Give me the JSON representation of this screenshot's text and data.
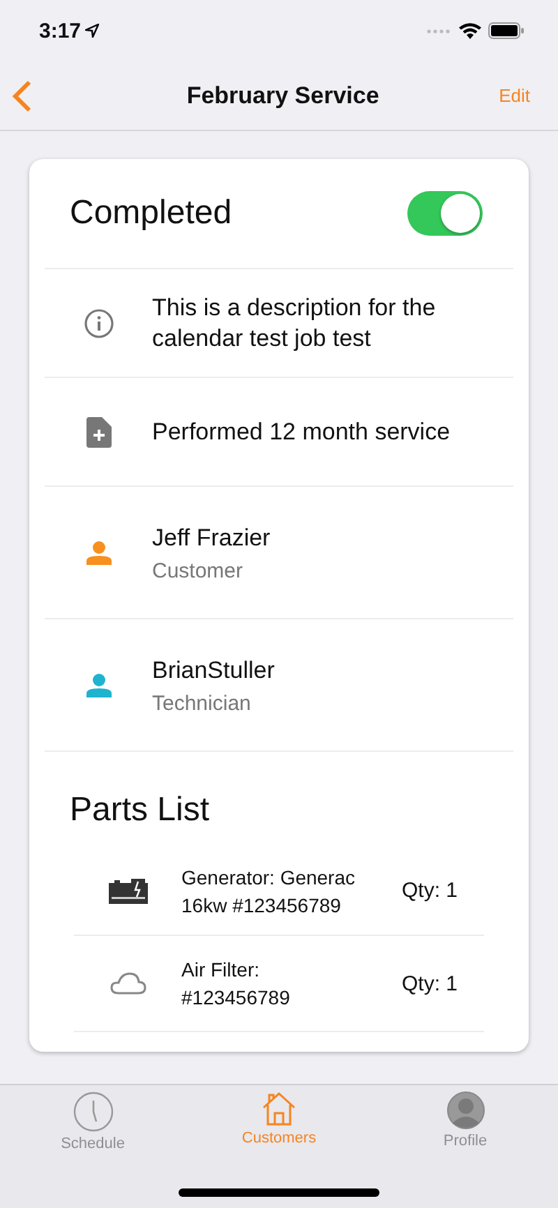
{
  "status_bar": {
    "time": "3:17"
  },
  "nav": {
    "title": "February Service",
    "action": "Edit"
  },
  "completed": {
    "label": "Completed",
    "on": true
  },
  "details": [
    {
      "kind": "info",
      "text": "This is a description for the calendar test job test"
    },
    {
      "kind": "note",
      "text": "Performed 12 month service"
    },
    {
      "kind": "person",
      "text": "Jeff Frazier",
      "role": "Customer",
      "color": "#f7901e"
    },
    {
      "kind": "person",
      "text": "BrianStuller",
      "role": "Technician",
      "color": "#1eb3cf"
    }
  ],
  "parts_title": "Parts List",
  "parts": [
    {
      "kind": "generator",
      "name": [
        "Generator: Generac",
        "16kw #123456789"
      ],
      "qty": "Qty: 1"
    },
    {
      "kind": "filter",
      "name": [
        "Air Filter:",
        "#123456789"
      ],
      "qty": "Qty: 1"
    }
  ],
  "tabs": [
    {
      "kind": "clock",
      "label": "Schedule",
      "selected": false
    },
    {
      "kind": "house",
      "label": "Customers",
      "selected": true
    },
    {
      "kind": "avatar",
      "label": "Profile",
      "selected": false
    }
  ]
}
